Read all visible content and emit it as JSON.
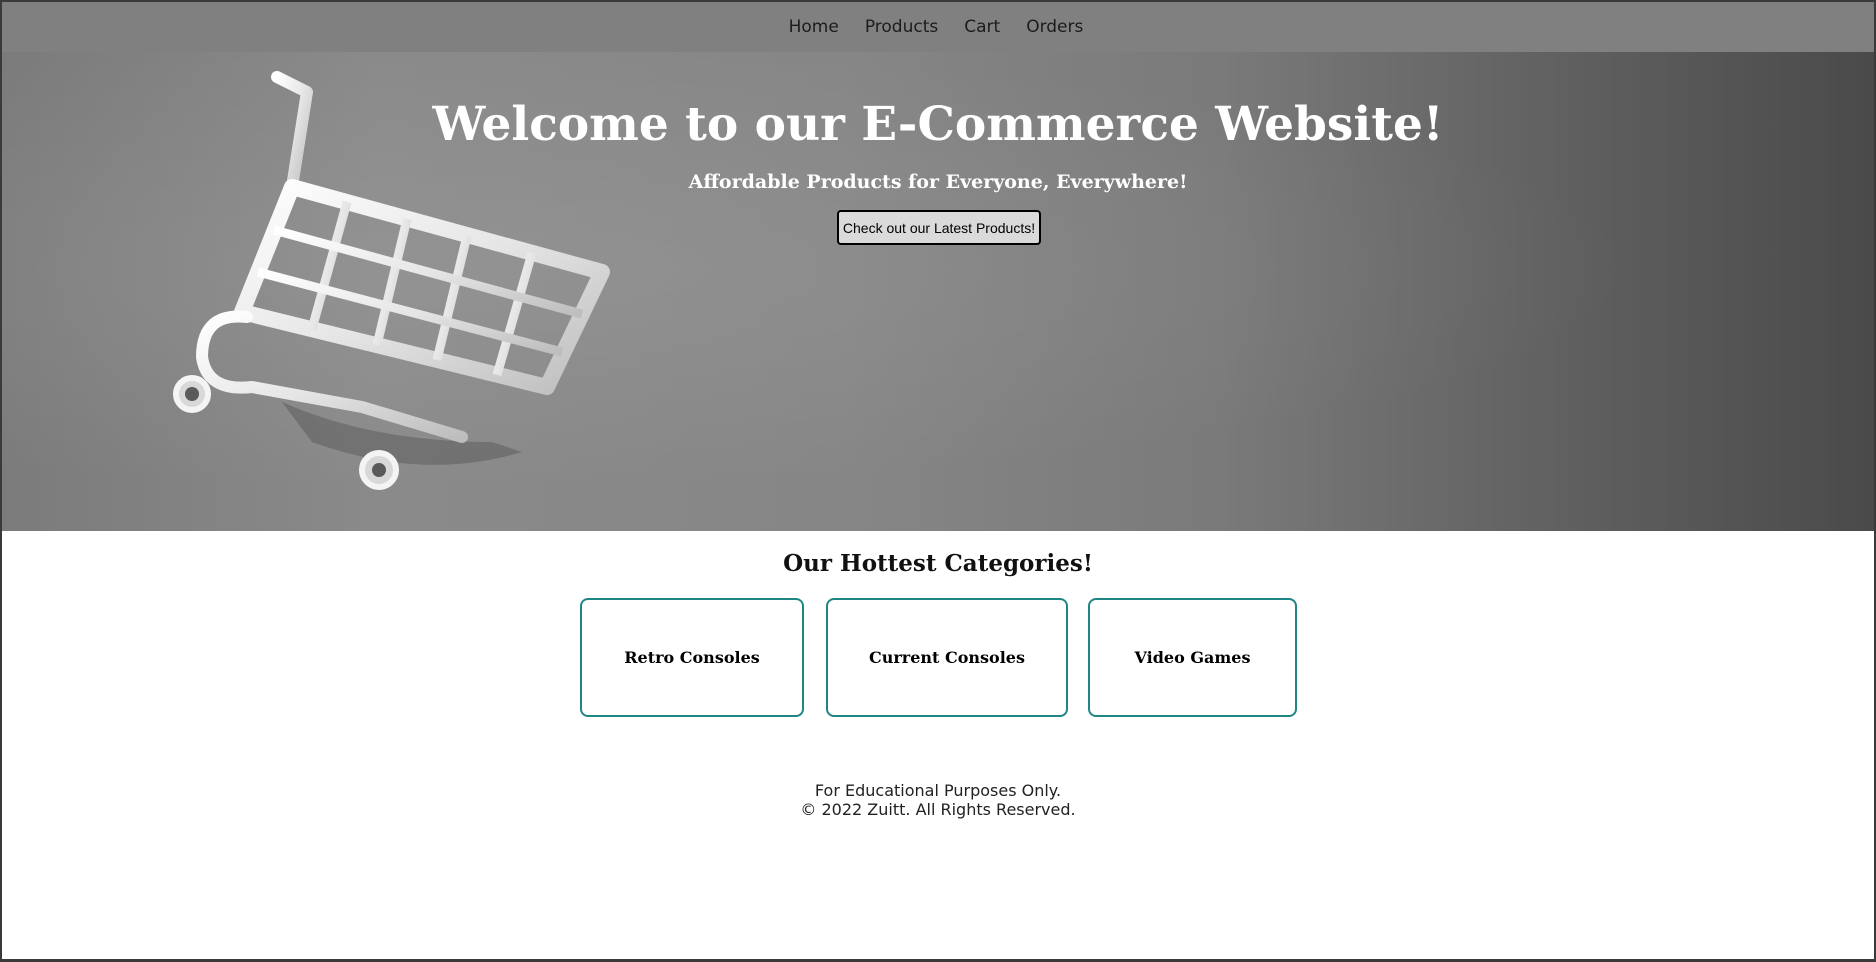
{
  "nav": {
    "items": [
      "Home",
      "Products",
      "Cart",
      "Orders"
    ]
  },
  "hero": {
    "title": "Welcome to our E-Commerce Website!",
    "subtitle": "Affordable Products for Everyone, Everywhere!",
    "button_label": "Check out our Latest Products!"
  },
  "categories": {
    "title": "Our Hottest Categories!",
    "items": [
      "Retro Consoles",
      "Current Consoles",
      "Video Games"
    ]
  },
  "footer": {
    "line1": "For Educational Purposes Only.",
    "line2": "© 2022 Zuitt. All Rights Reserved."
  },
  "colors": {
    "navbar": "#808080",
    "card_border": "#1f8585",
    "hero_text": "#ffffff"
  }
}
